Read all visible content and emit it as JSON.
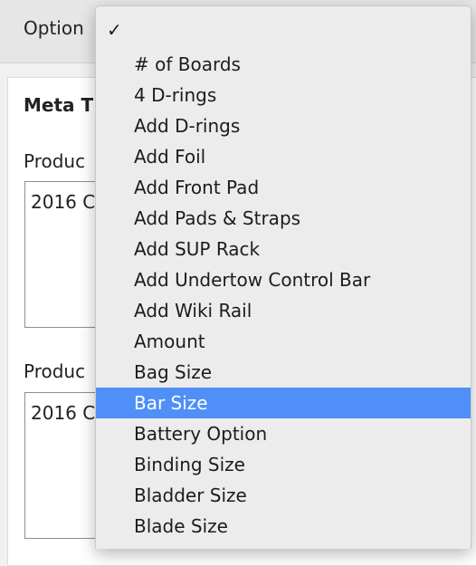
{
  "page": {
    "options_label": "Option",
    "meta_title": "Meta T",
    "field1_label": "Produc",
    "field1_value": "2016 C",
    "field2_label": "Produc",
    "field2_value": "2016 C"
  },
  "dropdown": {
    "check_mark": "✓",
    "check_item_label": "",
    "items": [
      {
        "label": "# of Boards"
      },
      {
        "label": "4 D-rings"
      },
      {
        "label": "Add D-rings"
      },
      {
        "label": "Add Foil"
      },
      {
        "label": "Add Front Pad"
      },
      {
        "label": "Add Pads & Straps"
      },
      {
        "label": "Add SUP Rack"
      },
      {
        "label": "Add Undertow Control Bar"
      },
      {
        "label": "Add Wiki Rail"
      },
      {
        "label": "Amount"
      },
      {
        "label": "Bag Size"
      },
      {
        "label": "Bar Size",
        "highlighted": true
      },
      {
        "label": "Battery Option"
      },
      {
        "label": "Binding Size"
      },
      {
        "label": "Bladder Size"
      },
      {
        "label": "Blade Size"
      }
    ],
    "highlight_color": "#4f8ff7"
  }
}
